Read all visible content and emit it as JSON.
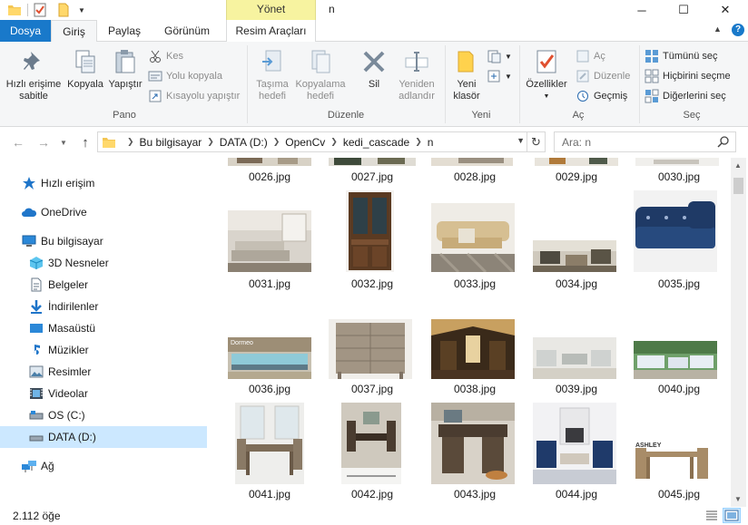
{
  "window": {
    "title": "n",
    "manage_tab": "Yönet",
    "minimize": "─",
    "maximize": "☐",
    "close": "✕"
  },
  "tabs": {
    "file": "Dosya",
    "home": "Giriş",
    "share": "Paylaş",
    "view": "Görünüm",
    "picture_tools": "Resim Araçları"
  },
  "ribbon": {
    "pano": {
      "label": "Pano",
      "pin": "Hızlı erişime sabitle",
      "copy": "Kopyala",
      "paste": "Yapıştır",
      "cut": "Kes",
      "copy_path": "Yolu kopyala",
      "paste_shortcut": "Kısayolu yapıştır"
    },
    "duzenle": {
      "label": "Düzenle",
      "move_to": "Taşıma hedefi",
      "copy_to": "Kopyalama hedefi",
      "delete": "Sil",
      "rename": "Yeniden adlandır"
    },
    "yeni": {
      "label": "Yeni",
      "new_folder": "Yeni klasör"
    },
    "ac": {
      "label": "Aç",
      "properties": "Özellikler",
      "open": "Aç",
      "edit": "Düzenle",
      "history": "Geçmiş"
    },
    "sec": {
      "label": "Seç",
      "select_all": "Tümünü seç",
      "select_none": "Hiçbirini seçme",
      "invert": "Diğerlerini seç"
    }
  },
  "address": {
    "crumbs": [
      "Bu bilgisayar",
      "DATA (D:)",
      "OpenCv",
      "kedi_cascade",
      "n"
    ],
    "search_placeholder": "Ara: n"
  },
  "sidebar": {
    "items": [
      {
        "label": "Hızlı erişim",
        "icon": "star-icon"
      },
      {
        "label": "OneDrive",
        "icon": "cloud-icon"
      },
      {
        "label": "Bu bilgisayar",
        "icon": "computer-icon"
      },
      {
        "label": "3D Nesneler",
        "icon": "cube-icon"
      },
      {
        "label": "Belgeler",
        "icon": "document-icon"
      },
      {
        "label": "İndirilenler",
        "icon": "download-icon"
      },
      {
        "label": "Masaüstü",
        "icon": "desktop-icon"
      },
      {
        "label": "Müzikler",
        "icon": "music-icon"
      },
      {
        "label": "Resimler",
        "icon": "pictures-icon"
      },
      {
        "label": "Videolar",
        "icon": "video-icon"
      },
      {
        "label": "OS (C:)",
        "icon": "drive-icon"
      },
      {
        "label": "DATA (D:)",
        "icon": "drive-icon"
      },
      {
        "label": "Ağ",
        "icon": "network-icon"
      }
    ]
  },
  "files": [
    {
      "name": "0026.jpg"
    },
    {
      "name": "0027.jpg"
    },
    {
      "name": "0028.jpg"
    },
    {
      "name": "0029.jpg"
    },
    {
      "name": "0030.jpg"
    },
    {
      "name": "0031.jpg"
    },
    {
      "name": "0032.jpg"
    },
    {
      "name": "0033.jpg"
    },
    {
      "name": "0034.jpg"
    },
    {
      "name": "0035.jpg"
    },
    {
      "name": "0036.jpg"
    },
    {
      "name": "0037.jpg"
    },
    {
      "name": "0038.jpg"
    },
    {
      "name": "0039.jpg"
    },
    {
      "name": "0040.jpg"
    },
    {
      "name": "0041.jpg"
    },
    {
      "name": "0042.jpg"
    },
    {
      "name": "0043.jpg"
    },
    {
      "name": "0044.jpg"
    },
    {
      "name": "0045.jpg"
    }
  ],
  "thumb_texts": {
    "t0036": "Dormeo",
    "t0045": "ASHLEY"
  },
  "status": {
    "item_count": "2.112 öğe"
  },
  "colors": {
    "accent": "#1979ca",
    "selection": "#cce8ff",
    "manage_tab": "#f7f3a0"
  }
}
